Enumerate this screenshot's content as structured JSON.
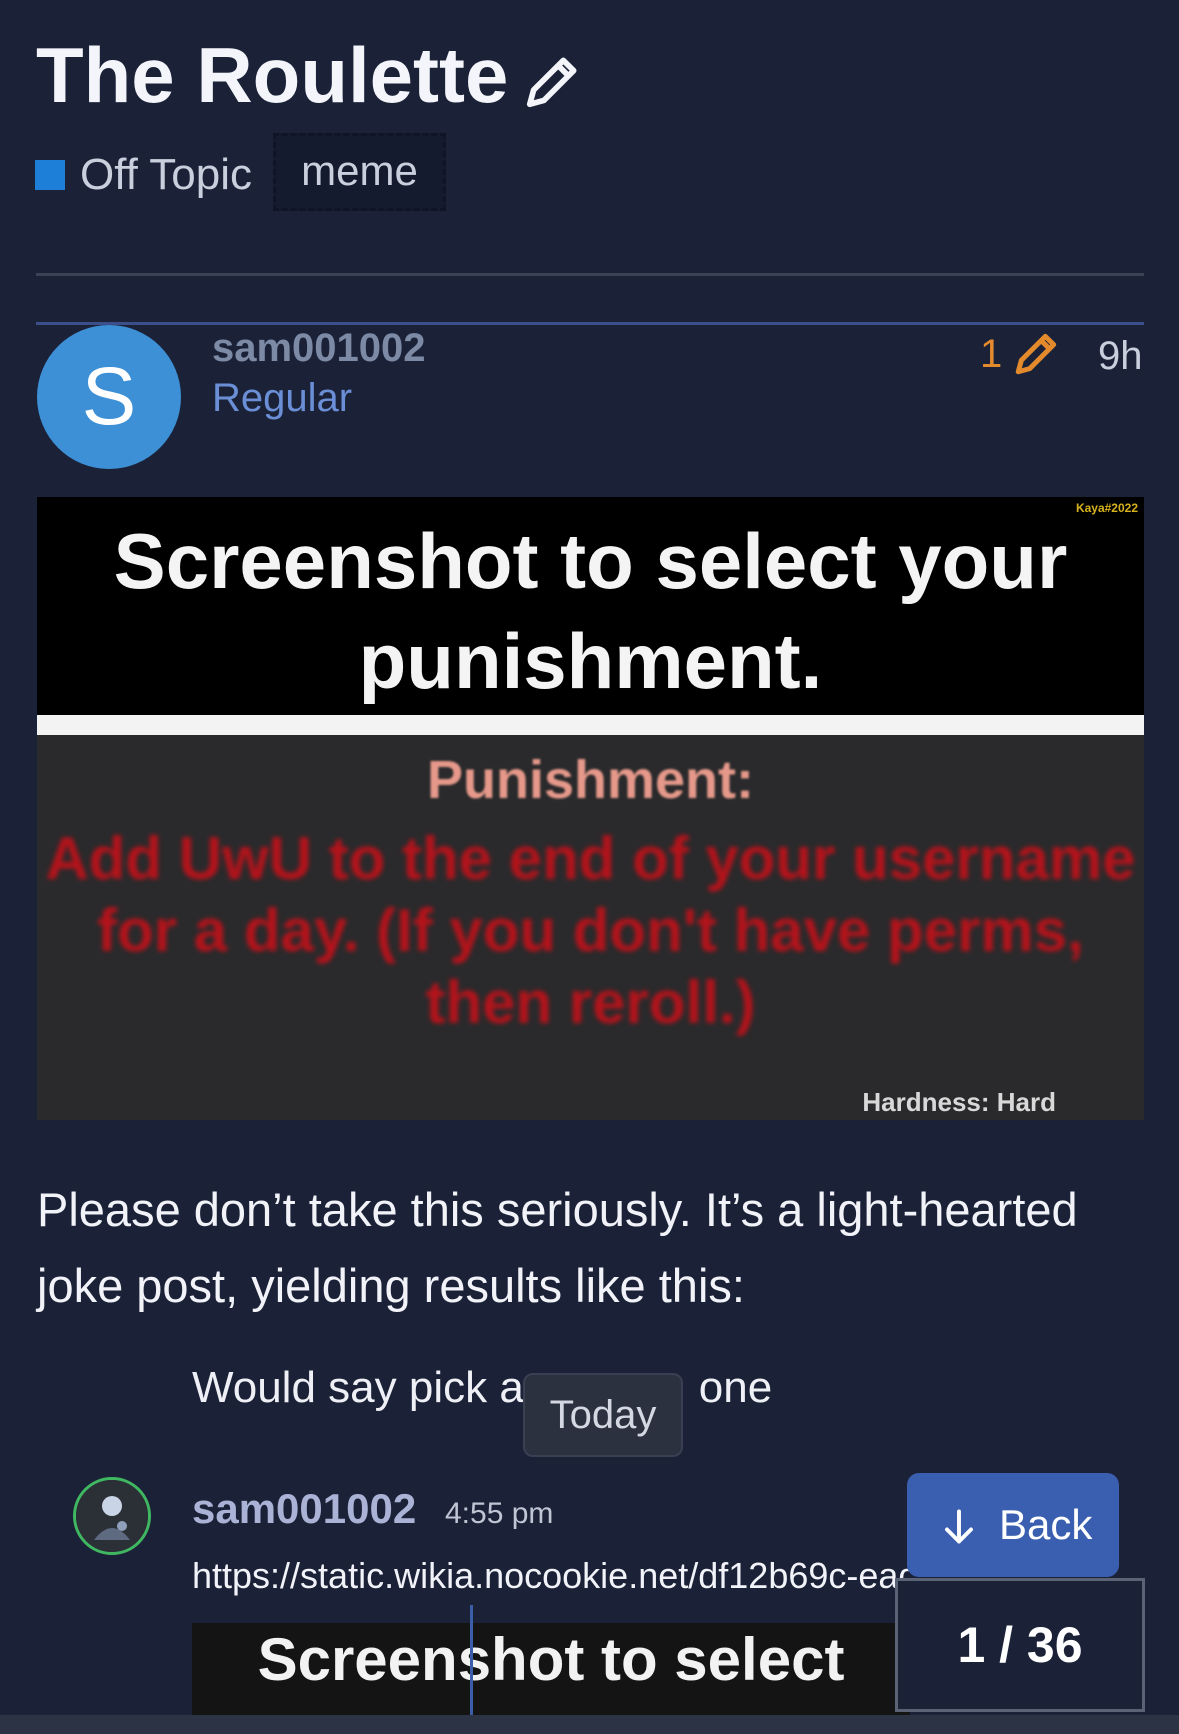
{
  "topic": {
    "title": "The Roulette",
    "category": "Off Topic",
    "tag": "meme"
  },
  "post": {
    "username": "sam001002",
    "user_title": "Regular",
    "avatar_letter": "S",
    "edit_count": "1",
    "age": "9h",
    "image": {
      "heading": "Screenshot to select your punishment.",
      "credit": "Kaya#2022",
      "punishment_label": "Punishment:",
      "punishment_text": "Add UwU to the end of your username for a day. (If you don't have perms, then reroll.)",
      "hardness": "Hardness: Hard"
    },
    "body": "Please don’t take this seriously. It’s a light-hearted joke post, yielding results like this:"
  },
  "quote": {
    "text_left": "Would say pick a",
    "text_right": "one"
  },
  "date_badge": "Today",
  "reply": {
    "username": "sam001002",
    "time": "4:55 pm",
    "link": "https://static.wikia.nocookie.net/df12b69c-ead",
    "preview_heading": "Screenshot to select"
  },
  "navigation": {
    "back_label": "Back",
    "progress": "1 / 36"
  },
  "colors": {
    "background": "#1b2238",
    "category": "#1e7fd8",
    "edit_count": "#e38a2c",
    "back_button": "#3b5fb0"
  }
}
